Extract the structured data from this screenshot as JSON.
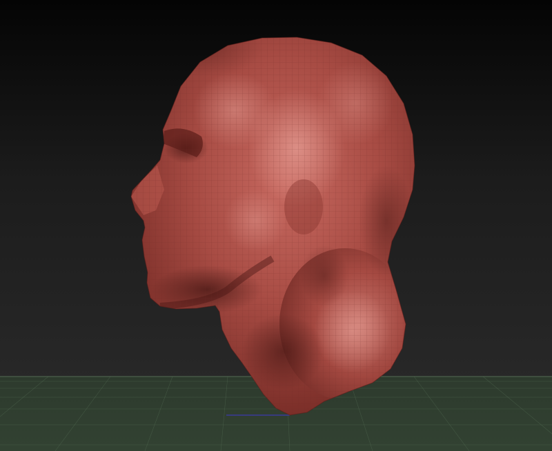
{
  "viewport": {
    "background_top": "#050505",
    "background_bottom": "#2c2c2c"
  },
  "floor": {
    "color": "#2f3d2f",
    "grid_line_color": "#5e7a5e",
    "axis_line_color": "#3a3a9a"
  },
  "model": {
    "icon": "sculpted-head-icon",
    "base_color": "#a3463f",
    "highlight_color": "#d6837b",
    "shadow_color": "#5a1e1a",
    "wireframe_color": "#7a302b"
  }
}
